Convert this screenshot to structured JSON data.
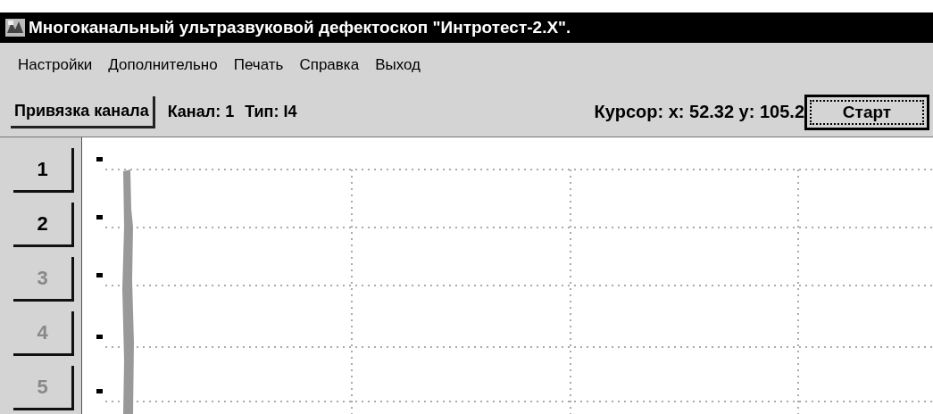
{
  "window": {
    "title": "Многоканальный ультразвуковой дефектоскоп \"Интротест-2.X\"."
  },
  "menu": [
    "Настройки",
    "Дополнительно",
    "Печать",
    "Справка",
    "Выход"
  ],
  "toolbar": {
    "bind_button": "Привязка канала",
    "channel_label": "Канал: 1",
    "type_label": "Тип: I4",
    "cursor": "Курсор: x: 52.32 y: 105.2",
    "start_button": "Старт"
  },
  "channels": [
    {
      "label": "1",
      "disabled": false
    },
    {
      "label": "2",
      "disabled": false
    },
    {
      "label": "3",
      "disabled": true
    },
    {
      "label": "4",
      "disabled": true
    },
    {
      "label": "5",
      "disabled": true
    }
  ]
}
